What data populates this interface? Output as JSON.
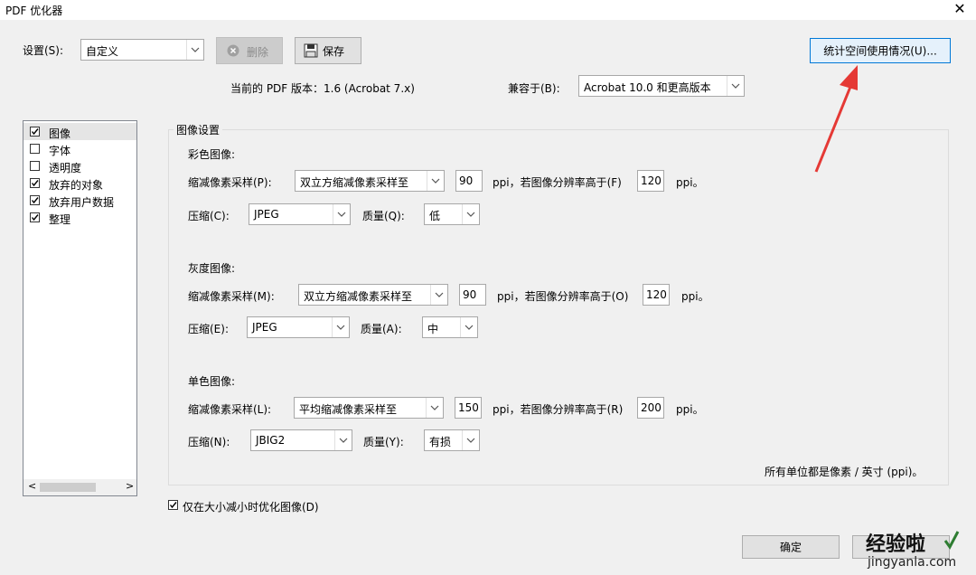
{
  "window": {
    "title": "PDF 优化器",
    "close_glyph": "✕"
  },
  "settings": {
    "label": "设置(S):",
    "value": "自定义"
  },
  "toolbar": {
    "delete_label": "删除",
    "save_label": "保存",
    "audit_label": "统计空间使用情况(U)..."
  },
  "version": {
    "label": "当前的 PDF 版本：1.6 (Acrobat 7.x)"
  },
  "compat": {
    "label": "兼容于(B):",
    "value": "Acrobat 10.0 和更高版本"
  },
  "sidebar": {
    "items": [
      {
        "label": "图像",
        "checked": true
      },
      {
        "label": "字体",
        "checked": false
      },
      {
        "label": "透明度",
        "checked": false
      },
      {
        "label": "放弃的对象",
        "checked": true
      },
      {
        "label": "放弃用户数据",
        "checked": true
      },
      {
        "label": "整理",
        "checked": true
      }
    ],
    "scroll_left": "<",
    "scroll_right": ">"
  },
  "image_settings": {
    "title": "图像设置",
    "color": {
      "heading": "彩色图像:",
      "downsample_label": "缩减像素采样(P):",
      "downsample_value": "双立方缩减像素采样至",
      "ppi": "90",
      "ppi_label": "ppi，若图像分辨率高于(F)",
      "above": "120",
      "unit": "ppi。",
      "compression_label": "压缩(C):",
      "compression_value": "JPEG",
      "quality_label": "质量(Q):",
      "quality_value": "低"
    },
    "gray": {
      "heading": "灰度图像:",
      "downsample_label": "缩减像素采样(M):",
      "downsample_value": "双立方缩减像素采样至",
      "ppi": "90",
      "ppi_label": "ppi，若图像分辨率高于(O)",
      "above": "120",
      "unit": "ppi。",
      "compression_label": "压缩(E):",
      "compression_value": "JPEG",
      "quality_label": "质量(A):",
      "quality_value": "中"
    },
    "mono": {
      "heading": "单色图像:",
      "downsample_label": "缩减像素采样(L):",
      "downsample_value": "平均缩减像素采样至",
      "ppi": "150",
      "ppi_label": "ppi，若图像分辨率高于(R)",
      "above": "200",
      "unit": "ppi。",
      "compression_label": "压缩(N):",
      "compression_value": "JBIG2",
      "quality_label": "质量(Y):",
      "quality_value": "有损"
    },
    "units_note": "所有单位都是像素 / 英寸 (ppi)。"
  },
  "optimize_only": {
    "label": "仅在大小减小时优化图像(D)",
    "checked": true
  },
  "footer": {
    "ok_label": "确定",
    "watermark_text": "经验啦",
    "watermark_url": "jingyanla.com"
  },
  "colors": {
    "annotation_arrow": "#e53935",
    "audit_border": "#0078d7",
    "watermark_check": "#2e7d32"
  }
}
